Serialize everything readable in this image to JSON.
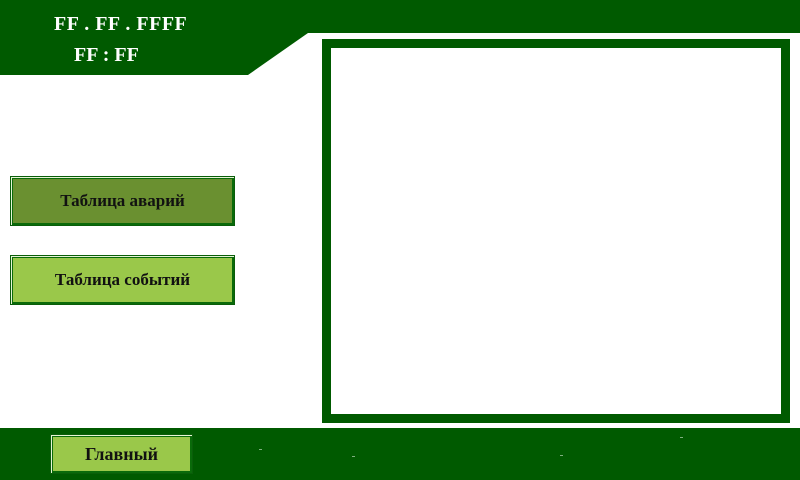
{
  "header": {
    "date": "FF . FF . FFFF",
    "time": "FF : FF"
  },
  "buttons": {
    "alarm_table": "Таблица аварий",
    "event_table": "Таблица событий"
  },
  "footer": {
    "main_label": "Главный"
  },
  "colors": {
    "dark_green": "#005a00",
    "button_active": "#6a9030",
    "button_light": "#9ac84a",
    "background": "#ffffff"
  }
}
